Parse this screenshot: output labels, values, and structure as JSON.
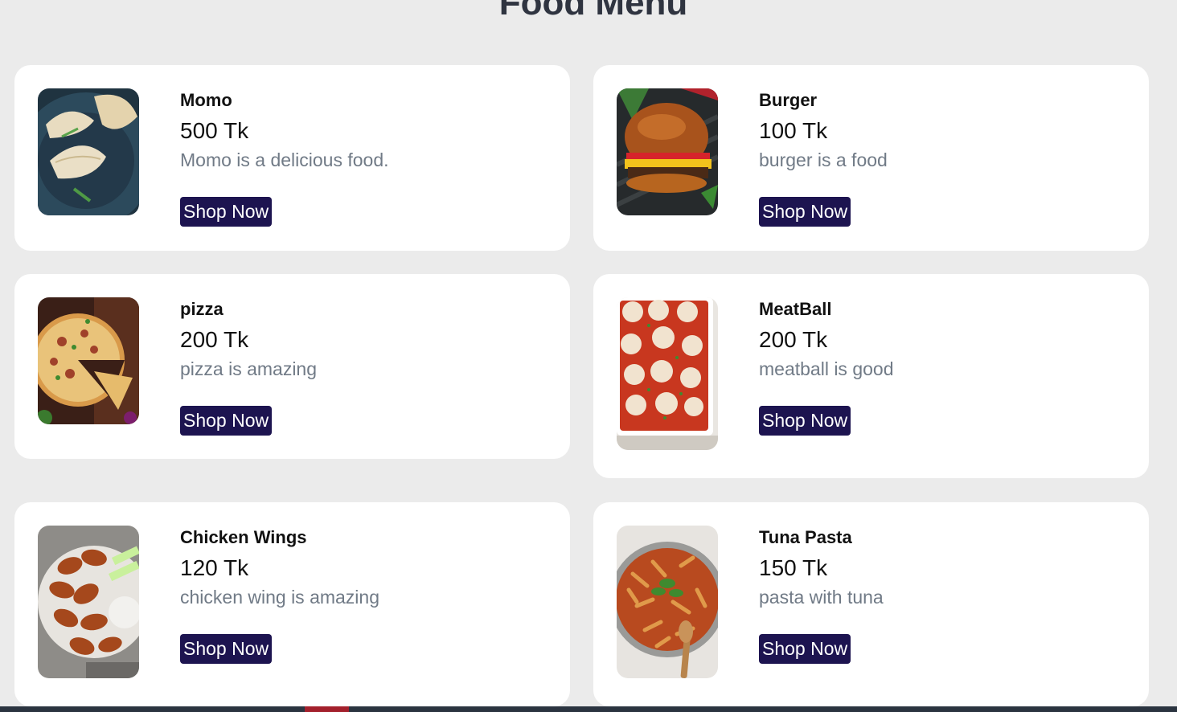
{
  "page": {
    "title": "Food Menu"
  },
  "items": [
    {
      "name": "Momo",
      "price": "500 Tk",
      "description": "Momo is a delicious food.",
      "button": "Shop Now",
      "image_icon": "momo-image"
    },
    {
      "name": "Burger",
      "price": "100 Tk",
      "description": "burger is a food",
      "button": "Shop Now",
      "image_icon": "burger-image"
    },
    {
      "name": "pizza",
      "price": "200 Tk",
      "description": "pizza is amazing",
      "button": "Shop Now",
      "image_icon": "pizza-image"
    },
    {
      "name": "MeatBall",
      "price": "200 Tk",
      "description": "meatball is good",
      "button": "Shop Now",
      "image_icon": "meatball-image"
    },
    {
      "name": "Chicken Wings",
      "price": "120 Tk",
      "description": "chicken wing is amazing",
      "button": "Shop Now",
      "image_icon": "chicken-wings-image"
    },
    {
      "name": "Tuna Pasta",
      "price": "150 Tk",
      "description": "pasta with tuna",
      "button": "Shop Now",
      "image_icon": "tuna-pasta-image"
    }
  ],
  "colors": {
    "background": "#ebebeb",
    "card": "#ffffff",
    "button": "#1d1450",
    "description": "#707a86",
    "footer": "#2b3440",
    "footer_accent": "#a3202c"
  }
}
